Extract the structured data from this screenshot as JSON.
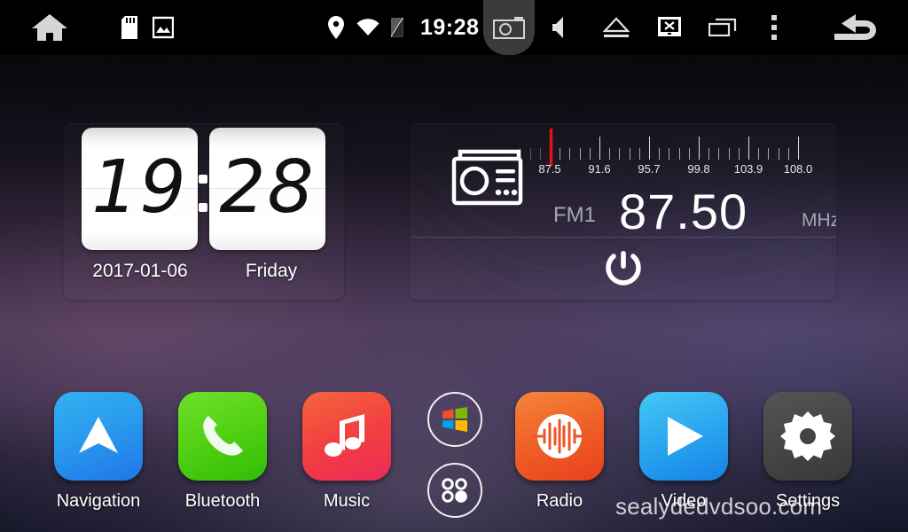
{
  "statusbar": {
    "clock": "19:28",
    "left_icons": [
      {
        "name": "home-icon",
        "label": "Home"
      },
      {
        "name": "sdcard-icon",
        "label": "SD Card"
      },
      {
        "name": "gallery-icon",
        "label": "Gallery"
      }
    ],
    "center_icons": [
      {
        "name": "location-pin-icon",
        "label": "Location"
      },
      {
        "name": "wifi-icon",
        "label": "Wi-Fi"
      },
      {
        "name": "signal-off-icon",
        "label": "No Signal"
      }
    ],
    "right_icons": [
      {
        "name": "camera-icon",
        "label": "Camera"
      },
      {
        "name": "volume-icon",
        "label": "Volume"
      },
      {
        "name": "eject-icon",
        "label": "Eject"
      },
      {
        "name": "screen-off-icon",
        "label": "Screen Off"
      },
      {
        "name": "recent-apps-icon",
        "label": "Recent Apps"
      },
      {
        "name": "overflow-menu-icon",
        "label": "More"
      },
      {
        "name": "back-icon",
        "label": "Back"
      }
    ]
  },
  "clock_widget": {
    "hour": "19",
    "minute": "28",
    "date": "2017-01-06",
    "weekday": "Friday"
  },
  "radio_widget": {
    "band": "FM1",
    "frequency": "87.50",
    "unit": "MHz",
    "needle_value": 87.5,
    "scale_min": 87.5,
    "scale_max": 108.0,
    "scale_labels": [
      "87.5",
      "91.6",
      "95.7",
      "99.8",
      "103.9",
      "108.0"
    ],
    "power_label": "Power",
    "accent_color": "#e01616"
  },
  "dock": {
    "apps": [
      {
        "label": "Navigation",
        "icon": "navigation-arrow-icon",
        "color1": "#32b1f0",
        "color2": "#1f76e8"
      },
      {
        "label": "Bluetooth",
        "icon": "phone-handset-icon",
        "color1": "#5fd820",
        "color2": "#36bf08"
      },
      {
        "label": "Music",
        "icon": "music-note-icon",
        "color1": "#f4543c",
        "color2": "#ef2a50"
      },
      {
        "label": "Radio",
        "icon": "radio-wave-icon",
        "color1": "#f2763a",
        "color2": "#e8431e"
      },
      {
        "label": "Video",
        "icon": "play-triangle-icon",
        "color1": "#3cc4f4",
        "color2": "#1b8ee8"
      },
      {
        "label": "Settings",
        "icon": "gear-icon",
        "color1": "#4c4c4c",
        "color2": "#3a3a3a"
      }
    ],
    "mini_buttons": [
      {
        "name": "windows-logo-icon",
        "label": "Windows"
      },
      {
        "name": "all-apps-icon",
        "label": "All Apps"
      }
    ]
  },
  "watermark": {
    "text": "sealydedvdsoo.com"
  }
}
